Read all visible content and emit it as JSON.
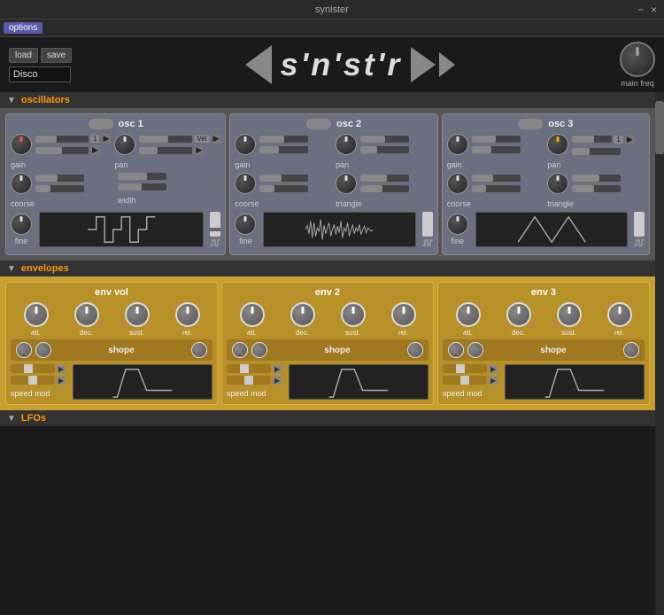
{
  "titlebar": {
    "title": "synister",
    "close": "×",
    "minimize": "−"
  },
  "menu": {
    "options_label": "options"
  },
  "header": {
    "load_label": "load",
    "save_label": "save",
    "preset_value": "Disco",
    "logo_text": "s'n'st'r",
    "main_freq_label": "main freq"
  },
  "sections": {
    "oscillators_label": "oscillators",
    "envelopes_label": "envelopes",
    "lfos_label": "LFOs"
  },
  "oscillators": [
    {
      "id": "osc1",
      "title": "osc 1",
      "gain_label": "gain",
      "pan_label": "pan",
      "coarse_label": "coorse",
      "width_label": "width",
      "fine_label": "fine",
      "vel_badge": "Vel",
      "num_badge": "1"
    },
    {
      "id": "osc2",
      "title": "osc 2",
      "gain_label": "gain",
      "pan_label": "pan",
      "coarse_label": "coorse",
      "triangle_label": "triangle",
      "fine_label": "fine"
    },
    {
      "id": "osc3",
      "title": "osc 3",
      "gain_label": "gain",
      "pan_label": "pan",
      "coarse_label": "coorse",
      "triangle_label": "triangle",
      "fine_label": "fine",
      "num_badge": "1"
    }
  ],
  "envelopes": [
    {
      "id": "env_vol",
      "title": "env vol",
      "att_label": "att.",
      "dec_label": "dec.",
      "sust_label": "sust.",
      "rel_label": "rel.",
      "shape_label": "shope",
      "speed_label": "speed mod"
    },
    {
      "id": "env2",
      "title": "env 2",
      "att_label": "att.",
      "dec_label": "dec.",
      "sust_label": "sust.",
      "rel_label": "rel.",
      "shape_label": "shope",
      "speed_label": "speed mod"
    },
    {
      "id": "env3",
      "title": "env 3",
      "att_label": "att.",
      "dec_label": "dec.",
      "sust_label": "sust.",
      "rel_label": "rel.",
      "shape_label": "shope",
      "speed_label": "speed mod"
    }
  ],
  "colors": {
    "accent_orange": "#f90",
    "osc_bg": "#6a7080",
    "env_bg": "#b89028",
    "env_section": "#c8a030"
  }
}
